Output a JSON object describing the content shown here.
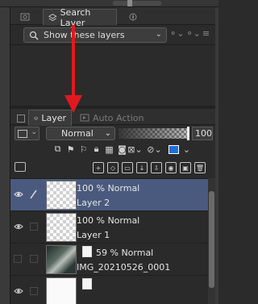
{
  "search_panel": {
    "tab_search_layer": "Search Layer",
    "filter_label": "Show these layers"
  },
  "layer_panel": {
    "tab_layer": "Layer",
    "tab_auto_action": "Auto Action",
    "blend_mode": "Normal",
    "opacity": "100",
    "layers": [
      {
        "mode": "100 % Normal",
        "name": "Layer 2",
        "selected": true
      },
      {
        "mode": "100 % Normal",
        "name": "Layer 1",
        "selected": false
      },
      {
        "mode": "59 % Normal",
        "name": "IMG_20210526_0001",
        "selected": false
      },
      {
        "mode": "",
        "name": "",
        "selected": false
      }
    ]
  },
  "annotation": {
    "arrow_color": "#e0191e"
  }
}
